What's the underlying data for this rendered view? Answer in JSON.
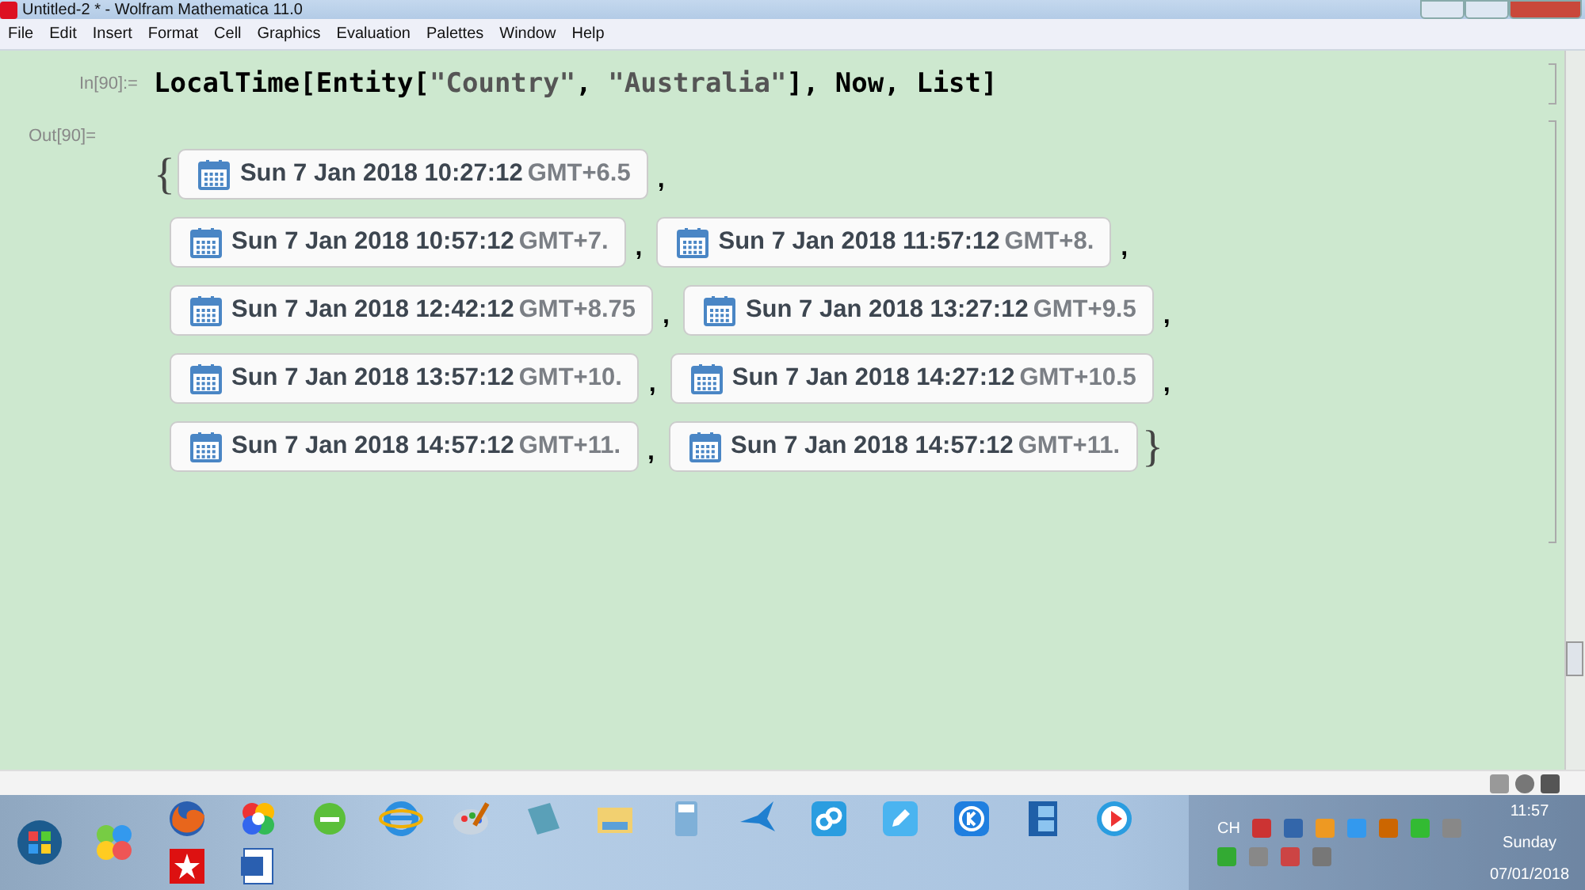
{
  "window": {
    "title": "Untitled-2 * - Wolfram Mathematica 11.0"
  },
  "menu": [
    "File",
    "Edit",
    "Insert",
    "Format",
    "Cell",
    "Graphics",
    "Evaluation",
    "Palettes",
    "Window",
    "Help"
  ],
  "input_cell": {
    "label": "In[90]:=",
    "code": [
      {
        "kind": "plain",
        "text": "LocalTime[Entity["
      },
      {
        "kind": "string",
        "text": "\"Country\""
      },
      {
        "kind": "plain",
        "text": ", "
      },
      {
        "kind": "string",
        "text": "\"Australia\""
      },
      {
        "kind": "plain",
        "text": "], Now, List]"
      }
    ]
  },
  "output_cell": {
    "label": "Out[90]=",
    "open_brace": "{",
    "close_brace": "}",
    "separator": ",",
    "rows": [
      [
        {
          "date": "Sun 7 Jan 2018 10:27:12",
          "zone": "GMT+6.5"
        }
      ],
      [
        {
          "date": "Sun 7 Jan 2018 10:57:12",
          "zone": "GMT+7."
        },
        {
          "date": "Sun 7 Jan 2018 11:57:12",
          "zone": "GMT+8."
        }
      ],
      [
        {
          "date": "Sun 7 Jan 2018 12:42:12",
          "zone": "GMT+8.75"
        },
        {
          "date": "Sun 7 Jan 2018 13:27:12",
          "zone": "GMT+9.5"
        }
      ],
      [
        {
          "date": "Sun 7 Jan 2018 13:57:12",
          "zone": "GMT+10."
        },
        {
          "date": "Sun 7 Jan 2018 14:27:12",
          "zone": "GMT+10.5"
        }
      ],
      [
        {
          "date": "Sun 7 Jan 2018 14:57:12",
          "zone": "GMT+11."
        },
        {
          "date": "Sun 7 Jan 2018 14:57:12",
          "zone": "GMT+11."
        }
      ]
    ]
  },
  "tray": {
    "language": "CH",
    "time": "11:57",
    "day": "Sunday",
    "date": "07/01/2018"
  }
}
